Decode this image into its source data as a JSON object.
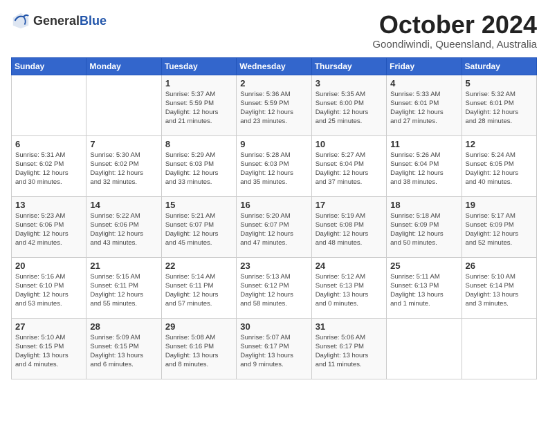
{
  "logo": {
    "general": "General",
    "blue": "Blue"
  },
  "title": "October 2024",
  "location": "Goondiwindi, Queensland, Australia",
  "weekdays": [
    "Sunday",
    "Monday",
    "Tuesday",
    "Wednesday",
    "Thursday",
    "Friday",
    "Saturday"
  ],
  "weeks": [
    [
      {
        "day": "",
        "info": ""
      },
      {
        "day": "",
        "info": ""
      },
      {
        "day": "1",
        "info": "Sunrise: 5:37 AM\nSunset: 5:59 PM\nDaylight: 12 hours\nand 21 minutes."
      },
      {
        "day": "2",
        "info": "Sunrise: 5:36 AM\nSunset: 5:59 PM\nDaylight: 12 hours\nand 23 minutes."
      },
      {
        "day": "3",
        "info": "Sunrise: 5:35 AM\nSunset: 6:00 PM\nDaylight: 12 hours\nand 25 minutes."
      },
      {
        "day": "4",
        "info": "Sunrise: 5:33 AM\nSunset: 6:01 PM\nDaylight: 12 hours\nand 27 minutes."
      },
      {
        "day": "5",
        "info": "Sunrise: 5:32 AM\nSunset: 6:01 PM\nDaylight: 12 hours\nand 28 minutes."
      }
    ],
    [
      {
        "day": "6",
        "info": "Sunrise: 5:31 AM\nSunset: 6:02 PM\nDaylight: 12 hours\nand 30 minutes."
      },
      {
        "day": "7",
        "info": "Sunrise: 5:30 AM\nSunset: 6:02 PM\nDaylight: 12 hours\nand 32 minutes."
      },
      {
        "day": "8",
        "info": "Sunrise: 5:29 AM\nSunset: 6:03 PM\nDaylight: 12 hours\nand 33 minutes."
      },
      {
        "day": "9",
        "info": "Sunrise: 5:28 AM\nSunset: 6:03 PM\nDaylight: 12 hours\nand 35 minutes."
      },
      {
        "day": "10",
        "info": "Sunrise: 5:27 AM\nSunset: 6:04 PM\nDaylight: 12 hours\nand 37 minutes."
      },
      {
        "day": "11",
        "info": "Sunrise: 5:26 AM\nSunset: 6:04 PM\nDaylight: 12 hours\nand 38 minutes."
      },
      {
        "day": "12",
        "info": "Sunrise: 5:24 AM\nSunset: 6:05 PM\nDaylight: 12 hours\nand 40 minutes."
      }
    ],
    [
      {
        "day": "13",
        "info": "Sunrise: 5:23 AM\nSunset: 6:06 PM\nDaylight: 12 hours\nand 42 minutes."
      },
      {
        "day": "14",
        "info": "Sunrise: 5:22 AM\nSunset: 6:06 PM\nDaylight: 12 hours\nand 43 minutes."
      },
      {
        "day": "15",
        "info": "Sunrise: 5:21 AM\nSunset: 6:07 PM\nDaylight: 12 hours\nand 45 minutes."
      },
      {
        "day": "16",
        "info": "Sunrise: 5:20 AM\nSunset: 6:07 PM\nDaylight: 12 hours\nand 47 minutes."
      },
      {
        "day": "17",
        "info": "Sunrise: 5:19 AM\nSunset: 6:08 PM\nDaylight: 12 hours\nand 48 minutes."
      },
      {
        "day": "18",
        "info": "Sunrise: 5:18 AM\nSunset: 6:09 PM\nDaylight: 12 hours\nand 50 minutes."
      },
      {
        "day": "19",
        "info": "Sunrise: 5:17 AM\nSunset: 6:09 PM\nDaylight: 12 hours\nand 52 minutes."
      }
    ],
    [
      {
        "day": "20",
        "info": "Sunrise: 5:16 AM\nSunset: 6:10 PM\nDaylight: 12 hours\nand 53 minutes."
      },
      {
        "day": "21",
        "info": "Sunrise: 5:15 AM\nSunset: 6:11 PM\nDaylight: 12 hours\nand 55 minutes."
      },
      {
        "day": "22",
        "info": "Sunrise: 5:14 AM\nSunset: 6:11 PM\nDaylight: 12 hours\nand 57 minutes."
      },
      {
        "day": "23",
        "info": "Sunrise: 5:13 AM\nSunset: 6:12 PM\nDaylight: 12 hours\nand 58 minutes."
      },
      {
        "day": "24",
        "info": "Sunrise: 5:12 AM\nSunset: 6:13 PM\nDaylight: 13 hours\nand 0 minutes."
      },
      {
        "day": "25",
        "info": "Sunrise: 5:11 AM\nSunset: 6:13 PM\nDaylight: 13 hours\nand 1 minute."
      },
      {
        "day": "26",
        "info": "Sunrise: 5:10 AM\nSunset: 6:14 PM\nDaylight: 13 hours\nand 3 minutes."
      }
    ],
    [
      {
        "day": "27",
        "info": "Sunrise: 5:10 AM\nSunset: 6:15 PM\nDaylight: 13 hours\nand 4 minutes."
      },
      {
        "day": "28",
        "info": "Sunrise: 5:09 AM\nSunset: 6:15 PM\nDaylight: 13 hours\nand 6 minutes."
      },
      {
        "day": "29",
        "info": "Sunrise: 5:08 AM\nSunset: 6:16 PM\nDaylight: 13 hours\nand 8 minutes."
      },
      {
        "day": "30",
        "info": "Sunrise: 5:07 AM\nSunset: 6:17 PM\nDaylight: 13 hours\nand 9 minutes."
      },
      {
        "day": "31",
        "info": "Sunrise: 5:06 AM\nSunset: 6:17 PM\nDaylight: 13 hours\nand 11 minutes."
      },
      {
        "day": "",
        "info": ""
      },
      {
        "day": "",
        "info": ""
      }
    ]
  ]
}
